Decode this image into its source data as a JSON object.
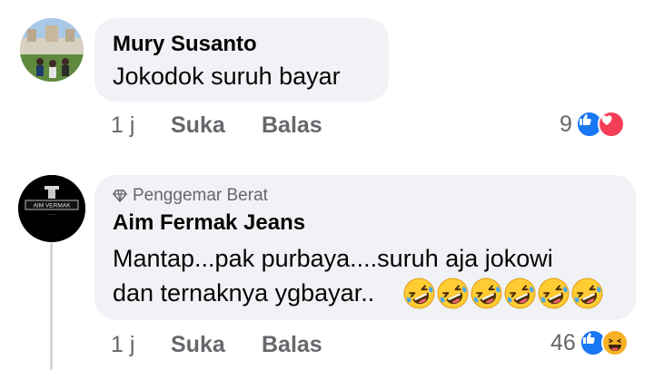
{
  "comments": [
    {
      "author": "Mury Susanto",
      "text": "Jokodok suruh bayar",
      "time": "1 j",
      "like_label": "Suka",
      "reply_label": "Balas",
      "reaction_count": "9",
      "reaction_icons": [
        "like-icon",
        "love-icon"
      ]
    },
    {
      "badge": "Penggemar Berat",
      "badge_icon": "diamond-icon",
      "author": "Aim Fermak Jeans",
      "avatar_text": "AIM VERMAK",
      "text_line1": "Mantap...pak purbaya....suruh aja jokowi",
      "text_line2": "dan ternaknya ygbayar..",
      "emoji": "rolling-on-floor-laughing-emoji",
      "emoji_count": 6,
      "time": "1 j",
      "like_label": "Suka",
      "reply_label": "Balas",
      "reaction_count": "46",
      "reaction_icons": [
        "like-icon",
        "haha-icon"
      ]
    }
  ],
  "colors": {
    "bubble": "#f0f2f5",
    "secondary_text": "#65676b",
    "like": "#1877f2",
    "love": "#f33e58",
    "haha": "#f7b125"
  }
}
